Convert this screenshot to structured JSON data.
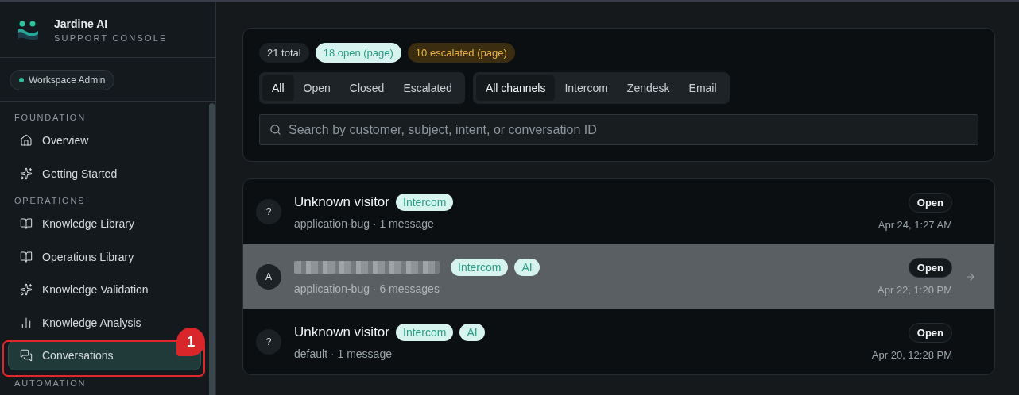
{
  "brand": {
    "name": "Jardine AI",
    "subtitle": "SUPPORT CONSOLE"
  },
  "role": {
    "label": "Workspace Admin",
    "color": "#2dbfa0"
  },
  "sidebar": {
    "sections": [
      {
        "title": "FOUNDATION",
        "items": [
          {
            "label": "Overview",
            "selected": false
          },
          {
            "label": "Getting Started",
            "selected": false
          }
        ]
      },
      {
        "title": "OPERATIONS",
        "items": [
          {
            "label": "Knowledge Library",
            "selected": false
          },
          {
            "label": "Operations Library",
            "selected": false
          },
          {
            "label": "Knowledge Validation",
            "selected": false
          },
          {
            "label": "Knowledge Analysis",
            "selected": false
          },
          {
            "label": "Conversations",
            "selected": true
          }
        ]
      },
      {
        "title": "AUTOMATION"
      }
    ]
  },
  "annotation": {
    "label": "1"
  },
  "summary": [
    {
      "label": "21 total",
      "kind": "neutral"
    },
    {
      "label": "18 open (page)",
      "kind": "open"
    },
    {
      "label": "10 escalated (page)",
      "kind": "escalated"
    }
  ],
  "status_filters": [
    {
      "label": "All",
      "selected": true
    },
    {
      "label": "Open",
      "selected": false
    },
    {
      "label": "Closed",
      "selected": false
    },
    {
      "label": "Escalated",
      "selected": false
    }
  ],
  "channel_filters": [
    {
      "label": "All channels",
      "selected": true
    },
    {
      "label": "Intercom",
      "selected": false
    },
    {
      "label": "Zendesk",
      "selected": false
    },
    {
      "label": "Email",
      "selected": false
    }
  ],
  "search": {
    "placeholder": "Search by customer, subject, intent, or conversation ID"
  },
  "conversations": [
    {
      "avatar": "?",
      "name": "Unknown visitor",
      "redacted": false,
      "tags": [
        "Intercom"
      ],
      "meta": "application-bug · 1 message",
      "status": "Open",
      "time": "Apr 24, 1:27 AM",
      "selected": false
    },
    {
      "avatar": "A",
      "redacted": true,
      "tags": [
        "Intercom",
        "AI"
      ],
      "meta": "application-bug · 6 messages",
      "status": "Open",
      "time": "Apr 22, 1:20 PM",
      "selected": true
    },
    {
      "avatar": "?",
      "name": "Unknown visitor",
      "redacted": false,
      "tags": [
        "Intercom",
        "AI"
      ],
      "meta": "default · 1 message",
      "status": "Open",
      "time": "Apr 20, 12:28 PM",
      "selected": false
    }
  ]
}
